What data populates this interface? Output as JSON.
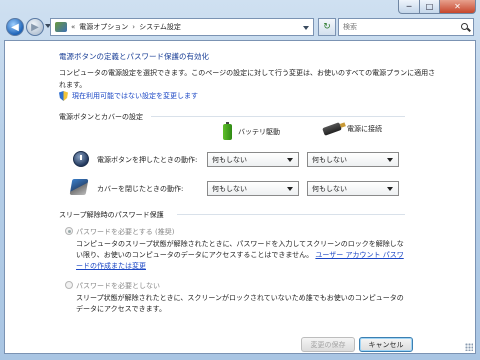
{
  "window": {
    "caption_min": "─",
    "caption_max": "□",
    "caption_close": "✕"
  },
  "nav": {
    "back_glyph": "◀",
    "forward_glyph": "▶",
    "crumb_prefix": "«",
    "crumb_sep": "›",
    "crumbs": [
      "電源オプション",
      "システム設定"
    ],
    "refresh_glyph": "↻",
    "search_placeholder": "検索"
  },
  "content": {
    "title": "電源ボタンの定義とパスワード保護の有効化",
    "description": "コンピュータの電源設定を選択できます。このページの設定に対して行う変更は、お使いのすべての電源プランに適用されます。",
    "change_link": "現在利用可能ではない設定を変更します"
  },
  "power_section": {
    "heading": "電源ボタンとカバーの設定",
    "col_battery": "バッテリ駆動",
    "col_plugged": "電源に接続",
    "rows": [
      {
        "label": "電源ボタンを押したときの動作:",
        "battery": "何もしない",
        "plugged": "何もしない"
      },
      {
        "label": "カバーを閉じたときの動作:",
        "battery": "何もしない",
        "plugged": "何もしない"
      }
    ]
  },
  "password_section": {
    "heading": "スリープ解除時のパスワード保護",
    "option1_label": "パスワードを必要とする (推奨)",
    "option1_desc": "コンピュータのスリープ状態が解除されたときに、パスワードを入力してスクリーンのロックを解除しない限り、お使いのコンピュータのデータにアクセスすることはできません。",
    "option1_link": "ユーザー アカウント パスワードの作成または変更",
    "option2_label": "パスワードを必要としない",
    "option2_desc": "スリープ状態が解除されたときに、スクリーンがロックされていないため誰でもお使いのコンピュータのデータにアクセスできます。"
  },
  "buttons": {
    "save": "変更の保存",
    "cancel": "キャンセル"
  }
}
